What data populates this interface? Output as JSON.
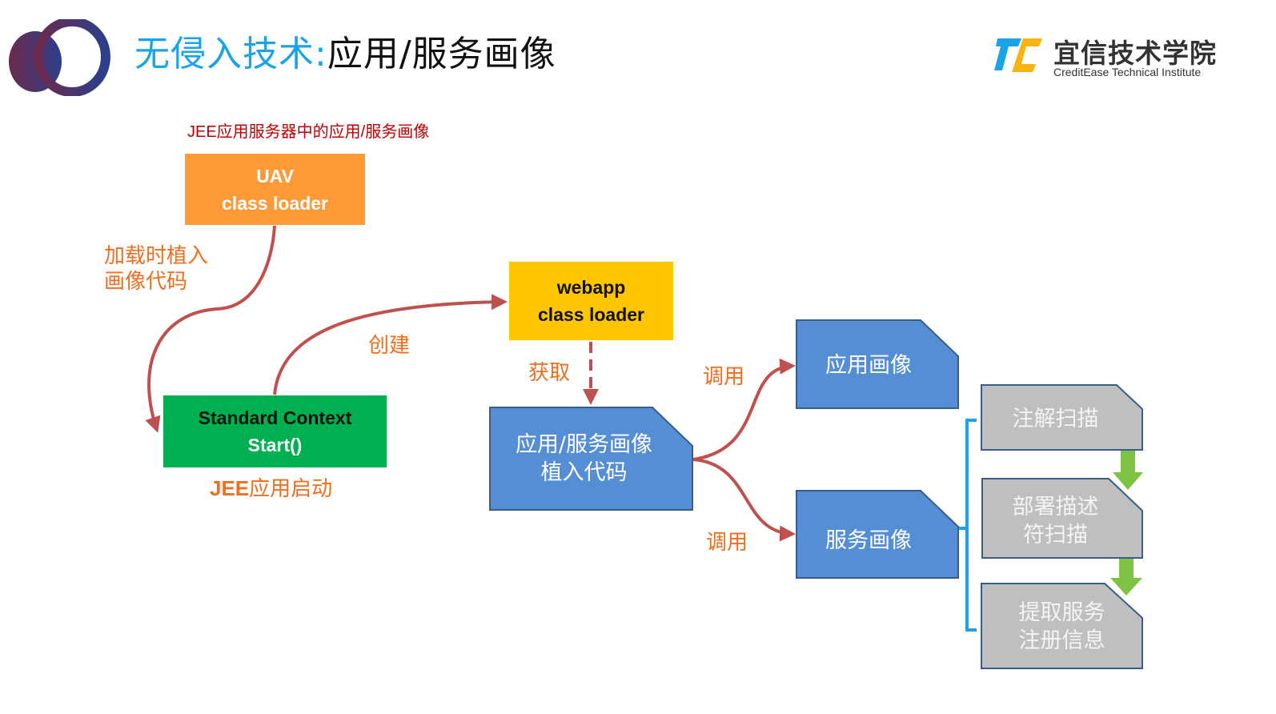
{
  "header": {
    "title_prefix": "无侵入技术:",
    "title_main": "应用/服务画像",
    "brand_name_cn": "宜信技术学院",
    "brand_name_en": "CreditEase Technical Institute",
    "logo_icon": "interlocking-rings-logo",
    "brand_icon": "tc-logo"
  },
  "diagram": {
    "subtitle": "JEE应用服务器中的应用/服务画像",
    "nodes": {
      "uav": {
        "line1": "UAV",
        "line2": "class loader",
        "color": "#ff9a36"
      },
      "webapp": {
        "line1": "webapp",
        "line2": "class loader",
        "color": "#ffc600"
      },
      "standard_context": {
        "line1": "Standard Context",
        "line2": "Start()",
        "color": "#00b050"
      },
      "inject_code": {
        "line1": "应用/服务画像",
        "line2": "植入代码",
        "color": "#558ed5"
      },
      "app_profile": {
        "line1": "应用画像",
        "color": "#558ed5"
      },
      "service_profile": {
        "line1": "服务画像",
        "color": "#558ed5"
      },
      "annotation_scan": {
        "line1": "注解扫描",
        "color": "#bfbfbf"
      },
      "descriptor_scan": {
        "line1": "部署描述",
        "line2": "符扫描",
        "color": "#bfbfbf"
      },
      "extract_registration": {
        "line1": "提取服务",
        "line2": "注册信息",
        "color": "#bfbfbf"
      }
    },
    "labels": {
      "load_inject_line1": "加载时植入",
      "load_inject_line2": "画像代码",
      "create": "创建",
      "get": "获取",
      "call_app": "调用",
      "call_service": "调用",
      "jee_start_prefix": "JEE",
      "jee_start_suffix": "应用启动"
    },
    "colors": {
      "arrow": "#c0504d",
      "label": "#f26d1e",
      "bracket": "#1aa3e6",
      "down_arrow": "#7dc242",
      "shape_border": "#385d8a"
    }
  }
}
